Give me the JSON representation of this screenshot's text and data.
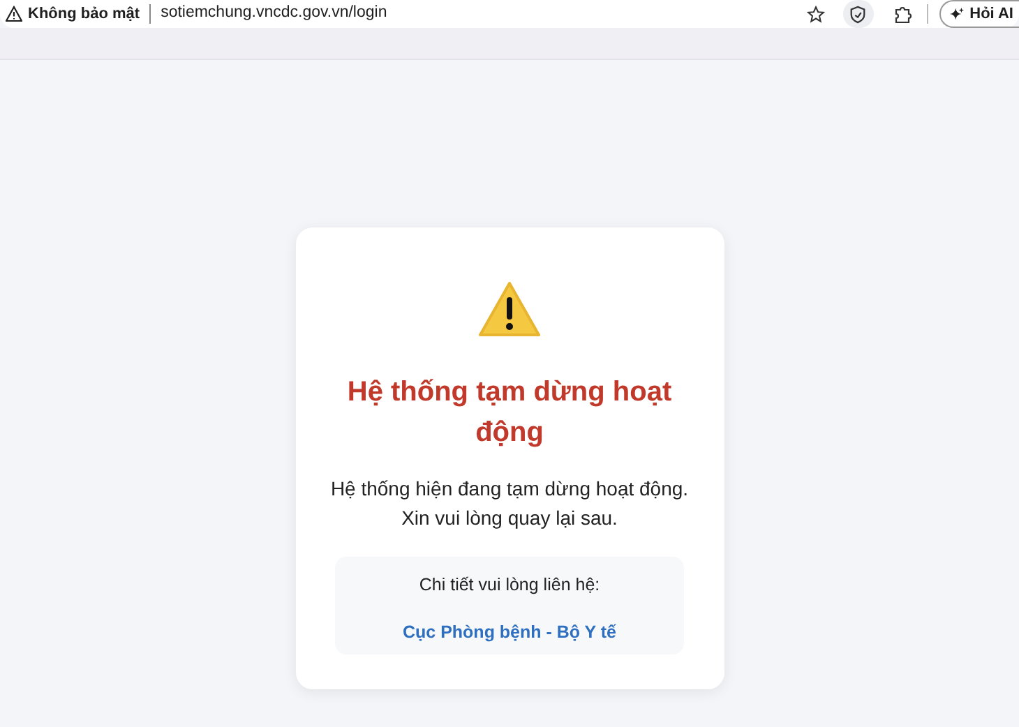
{
  "address_bar": {
    "security_label": "Không bảo mật",
    "url": "sotiemchung.vncdc.gov.vn/login",
    "ai_button": "Hỏi AI"
  },
  "notice": {
    "title": "Hệ thống tạm dừng hoạt động",
    "message": "Hệ thống hiện đang tạm dừng hoạt động. Xin vui lòng quay lại sau.",
    "contact": {
      "label": "Chi tiết vui lòng liên hệ:",
      "link": "Cục Phòng bệnh - Bộ Y tế"
    }
  }
}
